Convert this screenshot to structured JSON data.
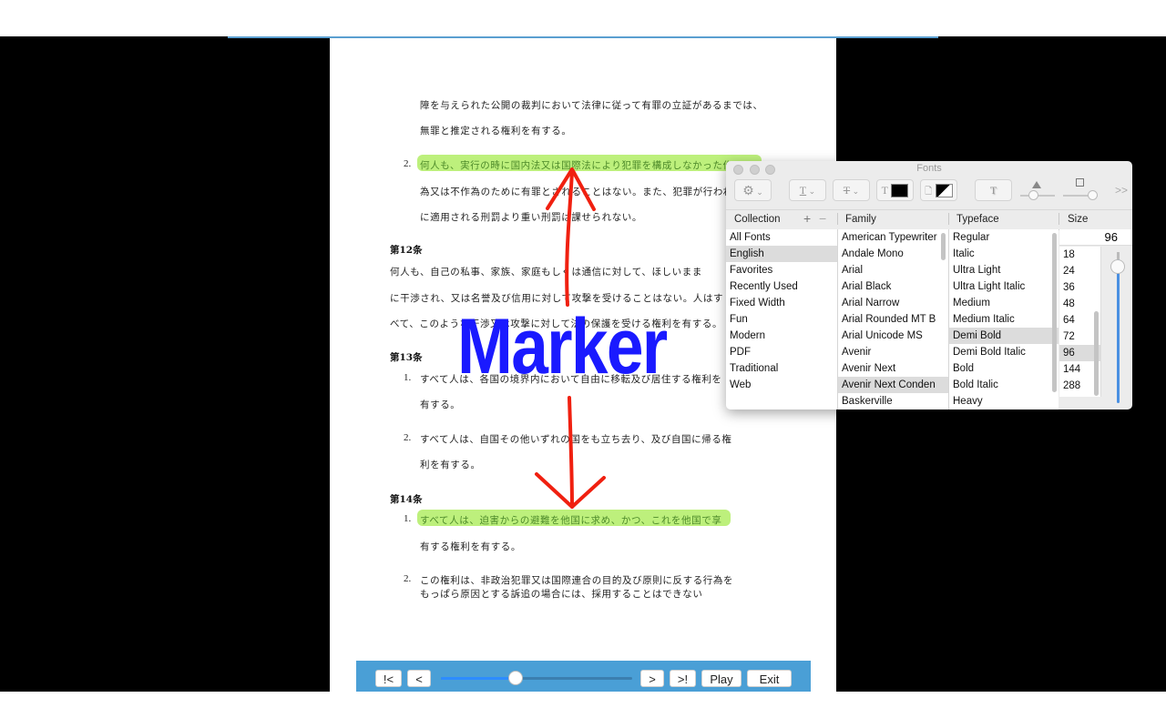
{
  "document": {
    "lines": [
      {
        "text": "障を与えられた公開の裁判において法律に従って有罪の立証があるまでは、",
        "highlight": false
      },
      {
        "text": "無罪と推定される権利を有する。",
        "highlight": false
      },
      {
        "number": "2.",
        "text": "何人も、実行の時に国内法又は国際法により犯罪を構成しなかった作",
        "highlight": true
      },
      {
        "text": "為又は不作為のために有罪とされることはない。また、犯罪が行われ",
        "highlight": false
      },
      {
        "text": "に適用される刑罰より重い刑罰は課せられない。",
        "highlight": false
      },
      {
        "heading": "第12条"
      },
      {
        "text": "何人も、自己の私事、家族、家庭もしくは通信に対して、ほしいまま",
        "highlight": false
      },
      {
        "text": "に干渉され、又は名誉及び信用に対して攻撃を受けることはない。人はす",
        "highlight": false
      },
      {
        "text": "べて、このような干渉又は攻撃に対して法の保護を受ける権利を有する。",
        "highlight": false
      },
      {
        "heading": "第13条"
      },
      {
        "number": "1.",
        "text": "すべて人は、各国の境界内において自由に移転及び居住する権利を",
        "highlight": false
      },
      {
        "text": "有する。",
        "highlight": false
      },
      {
        "number": "2.",
        "text": "すべて人は、自国その他いずれの国をも立ち去り、及び自国に帰る権",
        "highlight": false
      },
      {
        "text": "利を有する。",
        "highlight": false
      },
      {
        "heading": "第14条"
      },
      {
        "number": "1.",
        "text": "すべて人は、迫害からの避難を他国に求め、かつ、これを他国で享",
        "highlight": true
      },
      {
        "text": "有する権利を有する。",
        "highlight": false
      },
      {
        "number": "2.",
        "text": "この権利は、非政治犯罪又は国際連合の目的及び原則に反する行為を",
        "highlight": false
      },
      {
        "text": "もっぱら原因とする訴追の場合には、採用することはできない",
        "highlight": false
      }
    ]
  },
  "annotation": {
    "marker_text": "Marker",
    "marker_color": "#1a1aff",
    "arrow_color": "#f02010",
    "highlight_color": "#b6ee6e"
  },
  "player": {
    "first_label": "!<",
    "prev_label": "<",
    "next_label": ">",
    "last_label": ">!",
    "play_label": "Play",
    "exit_label": "Exit",
    "slider_fraction": 0.39
  },
  "fonts_panel": {
    "title": "Fonts",
    "toolbar": {
      "action_icon": "gear-icon",
      "underline_icon": "underline-icon",
      "strikethrough_icon": "strikethrough-icon",
      "text_color_icon": "text-color-icon",
      "document_color_icon": "document-color-icon",
      "shadow_icon": "text-shadow-icon",
      "more_label": ">>"
    },
    "columns": {
      "collection": "Collection",
      "family": "Family",
      "typeface": "Typeface",
      "size": "Size"
    },
    "collections": [
      "All Fonts",
      "English",
      "Favorites",
      "Recently Used",
      "Fixed Width",
      "Fun",
      "Modern",
      "PDF",
      "Traditional",
      "Web"
    ],
    "selected_collection": "English",
    "families": [
      "American Typewriter",
      "Andale Mono",
      "Arial",
      "Arial Black",
      "Arial Narrow",
      "Arial Rounded MT B",
      "Arial Unicode MS",
      "Avenir",
      "Avenir Next",
      "Avenir Next Conden",
      "Baskerville"
    ],
    "selected_family": "Avenir Next Conden",
    "typefaces": [
      "Regular",
      "Italic",
      "Ultra Light",
      "Ultra Light Italic",
      "Medium",
      "Medium Italic",
      "Demi Bold",
      "Demi Bold Italic",
      "Bold",
      "Bold Italic",
      "Heavy"
    ],
    "selected_typeface": "Demi Bold",
    "size_value": "96",
    "sizes": [
      "18",
      "24",
      "36",
      "48",
      "64",
      "72",
      "96",
      "144",
      "288"
    ],
    "selected_size": "96"
  }
}
